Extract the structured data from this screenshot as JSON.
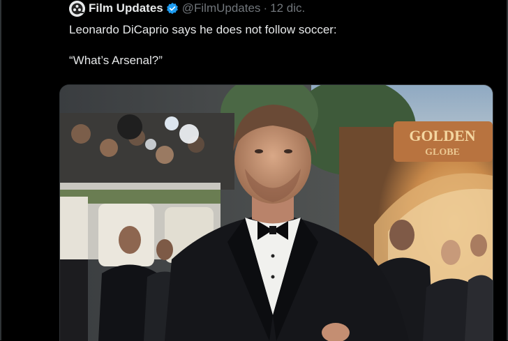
{
  "tweet": {
    "author_name": "Film Updates",
    "handle": "@FilmUpdates",
    "separator": "·",
    "date": "12 dic.",
    "text_line_1": "Leonardo DiCaprio says he does not follow soccer:",
    "text_line_2": "“What’s Arsenal?”"
  },
  "photo": {
    "sign_line_1": "GOLDEN",
    "sign_line_2": "GLOBE",
    "icons": {
      "avatar": "avatar-icon",
      "verified": "verified-badge-icon"
    }
  },
  "colors": {
    "background": "#000000",
    "text": "#e7e9ea",
    "muted": "#71767b",
    "verified": "#1d9bf0",
    "border": "#2f3336"
  }
}
